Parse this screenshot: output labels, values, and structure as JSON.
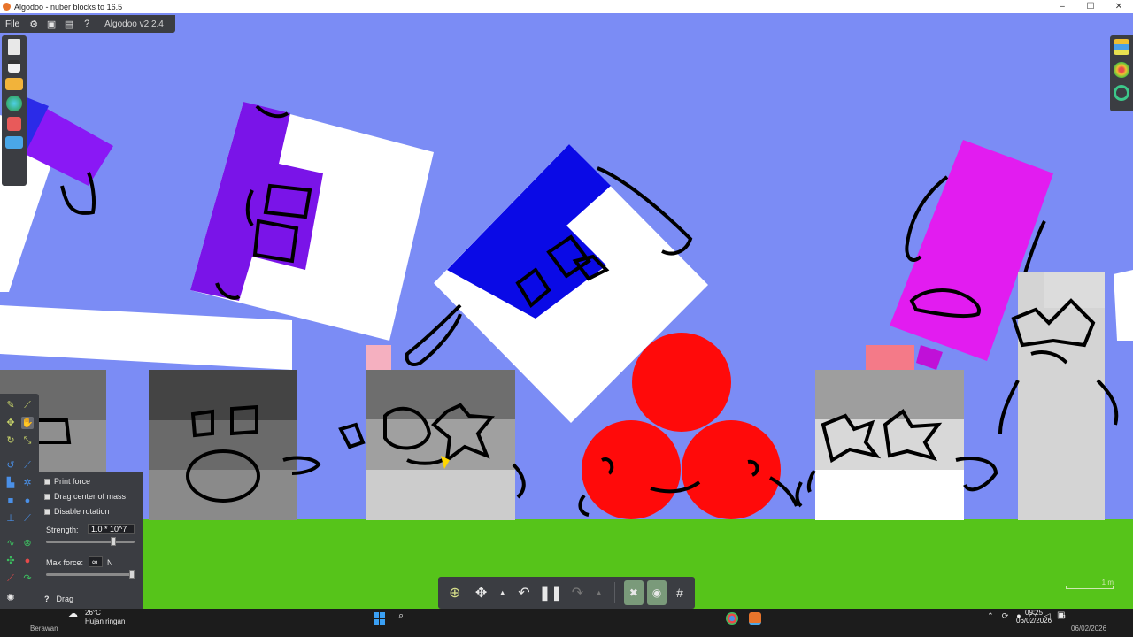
{
  "window": {
    "title": "Algodoo - nuber blocks to 16.5",
    "controls": [
      "–",
      "☐",
      "✕"
    ]
  },
  "topbar": {
    "file_menu": "File",
    "version": "Algodoo v2.2.4",
    "icons": [
      "gear-icon",
      "window-icon",
      "panel-icon",
      "help-icon"
    ],
    "help_glyph": "?"
  },
  "left_toolbar": {
    "icons": [
      "new-scene-icon",
      "window-icon",
      "open-folder-icon",
      "scene-library-icon",
      "game-icon",
      "scene-folder-icon"
    ]
  },
  "right_toolbar": {
    "icons": [
      "layers-icon",
      "palette-icon",
      "search-icon"
    ]
  },
  "drag_panel": {
    "options": [
      {
        "label": "Print force",
        "checked": false
      },
      {
        "label": "Drag center of mass",
        "checked": false
      },
      {
        "label": "Disable rotation",
        "checked": false
      }
    ],
    "strength_label": "Strength:",
    "strength_value": "1.0 * 10^7",
    "strength_level": 0.78,
    "max_force_label": "Max force:",
    "max_force_value": "∞",
    "max_force_unit": "N",
    "max_force_level": 1.0,
    "tool_name": "Drag",
    "help_glyph": "?"
  },
  "playbar": {
    "buttons": [
      "zoom-icon",
      "move-icon",
      "undo-options-icon",
      "undo-icon",
      "pause-icon",
      "redo-icon",
      "redo-options-icon",
      "clear-icon",
      "camera-icon",
      "grid-icon"
    ]
  },
  "scale": {
    "label": "1 m"
  },
  "taskbar": {
    "temperature": "26°C",
    "weather": "Hujan ringan",
    "user": "Berawan",
    "time": "09:25",
    "date": "06/02/2026",
    "date_secondary": "06/02/2026"
  },
  "colors": {
    "sky": "#7b8cf5",
    "ground": "#56c41a",
    "panel": "#3b3d42",
    "accent_yellow": "#c8d46a"
  }
}
